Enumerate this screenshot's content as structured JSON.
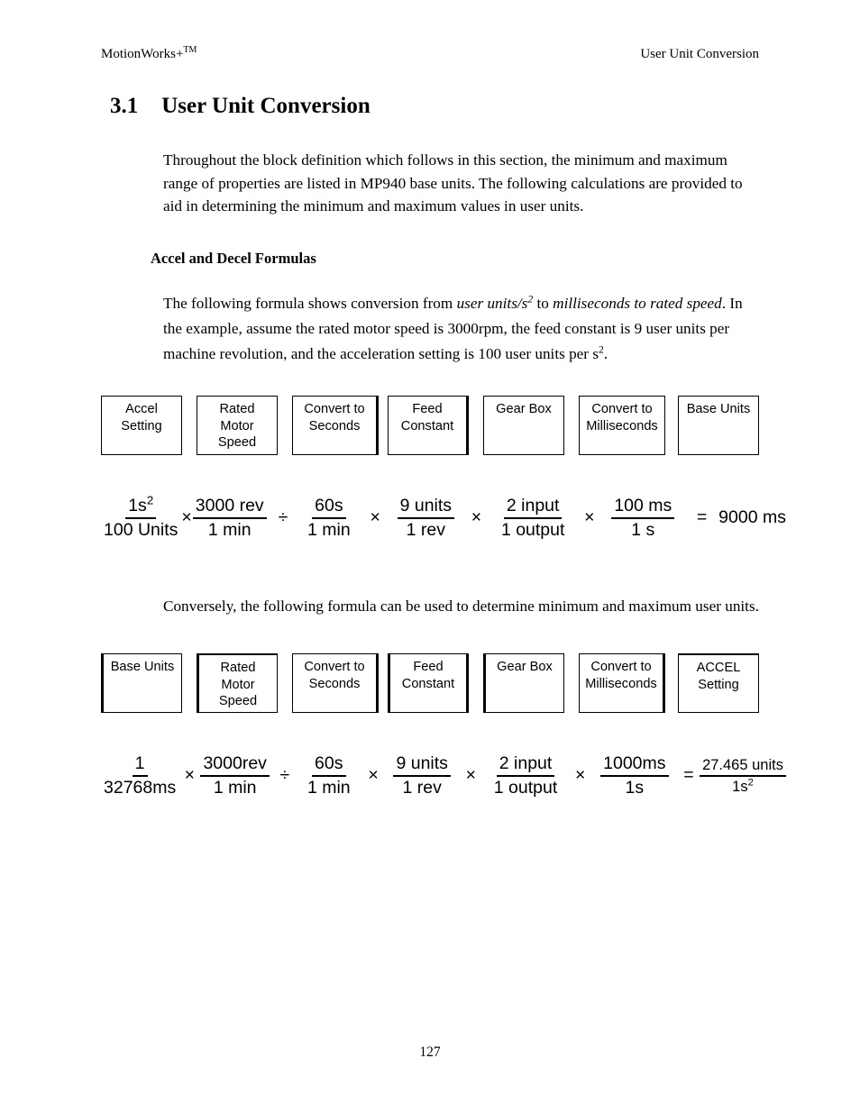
{
  "header": {
    "left_text": "MotionWorks+",
    "left_superscript": "TM",
    "right_text": "User Unit Conversion"
  },
  "section": {
    "number": "3.1",
    "title": "User Unit Conversion"
  },
  "paragraphs": {
    "intro": "Throughout the block definition which follows in this section, the minimum and maximum range of properties are listed in MP940 base units.  The following calculations are provided to aid in determining the minimum and maximum values in user units.",
    "conversely": "Conversely, the following formula can be used to determine minimum and maximum user units."
  },
  "sub_heading": "Accel and Decel Formulas",
  "formula_description": {
    "part_1": "The following formula shows conversion from ",
    "italic_1": "user units/s",
    "italic_1_sup": "2",
    "part_2": " to ",
    "italic_2": "milliseconds to rated speed",
    "part_3": ". In the example, assume the rated motor speed is 3000rpm, the feed constant is 9 user units per machine revolution, and the acceleration setting is 100 user units per s",
    "part_3_sup": "2",
    "part_4": "."
  },
  "diagram_row_1": {
    "boxes": [
      {
        "lines": [
          "Accel",
          "Setting"
        ]
      },
      {
        "lines": [
          "Rated",
          "Motor",
          "Speed"
        ]
      },
      {
        "lines": [
          "Convert to",
          "Seconds"
        ]
      },
      {
        "lines": [
          "Feed",
          "Constant"
        ]
      },
      {
        "lines": [
          "Gear Box"
        ]
      },
      {
        "lines": [
          "Convert to",
          "Milliseconds"
        ]
      },
      {
        "lines": [
          "Base Units"
        ]
      }
    ]
  },
  "diagram_row_2": {
    "boxes": [
      {
        "lines": [
          "Base Units"
        ]
      },
      {
        "lines": [
          "Rated",
          "Motor",
          "Speed"
        ]
      },
      {
        "lines": [
          "Convert to",
          "Seconds"
        ]
      },
      {
        "lines": [
          "Feed",
          "Constant"
        ]
      },
      {
        "lines": [
          "Gear Box"
        ]
      },
      {
        "lines": [
          "Convert to",
          "Milliseconds"
        ]
      },
      {
        "lines": [
          "ACCEL",
          "Setting"
        ]
      }
    ]
  },
  "formula_1": {
    "f1_num": "1s",
    "f1_num_sup": "2",
    "f1_den": "100 Units",
    "op1": "×",
    "f2_num": "3000 rev",
    "f2_den": "1 min",
    "op2": "÷",
    "f3_num": "60s",
    "f3_den": "1 min",
    "op3": "×",
    "f4_num": "9 units",
    "f4_den": "1 rev",
    "op4": "×",
    "f5_num": "2 input",
    "f5_den": "1 output",
    "op5": "×",
    "f6_num": "100 ms",
    "f6_den": "1 s",
    "equals": "=",
    "result": "9000 ms"
  },
  "formula_2": {
    "f1_num": "1",
    "f1_den": "32768ms",
    "op1": "×",
    "f2_num": "3000rev",
    "f2_den": "1 min",
    "op2": "÷",
    "f3_num": "60s",
    "f3_den": "1 min",
    "op3": "×",
    "f4_num": "9 units",
    "f4_den": "1 rev",
    "op4": "×",
    "f5_num": "2 input",
    "f5_den": "1 output",
    "op5": "×",
    "f6_num": "1000ms",
    "f6_den": "1s",
    "equals": "=",
    "result_num": "27.465 units",
    "result_den": "1s",
    "result_den_sup": "2"
  },
  "page_number": "127"
}
